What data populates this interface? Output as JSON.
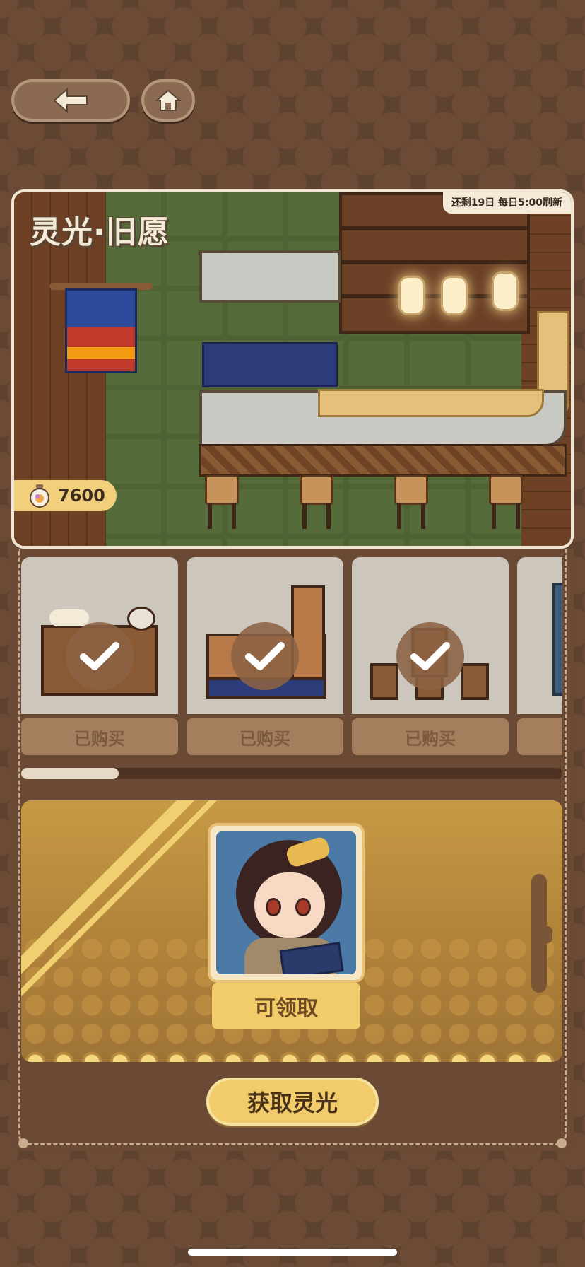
{
  "nav": {
    "back_icon": "arrow-left-icon",
    "home_icon": "home-icon"
  },
  "scene": {
    "title": "灵光·旧愿",
    "refresh_notice": "还剩19日 每日5:00刷新",
    "currency_icon": "lightbulb-jar-icon",
    "currency_value": "7600"
  },
  "items": [
    {
      "name": "sushi-counter",
      "status": "已购买"
    },
    {
      "name": "wooden-counter",
      "status": "已购买"
    },
    {
      "name": "stools",
      "status": "已购买"
    }
  ],
  "scroll": {
    "progress": 0.18
  },
  "reward": {
    "claim_label": "可领取"
  },
  "actions": {
    "get_light_label": "获取灵光"
  },
  "colors": {
    "background": "#5e4230",
    "panel": "#6a4a34",
    "accent": "#f2cc6a",
    "card": "#cdc6bd"
  }
}
